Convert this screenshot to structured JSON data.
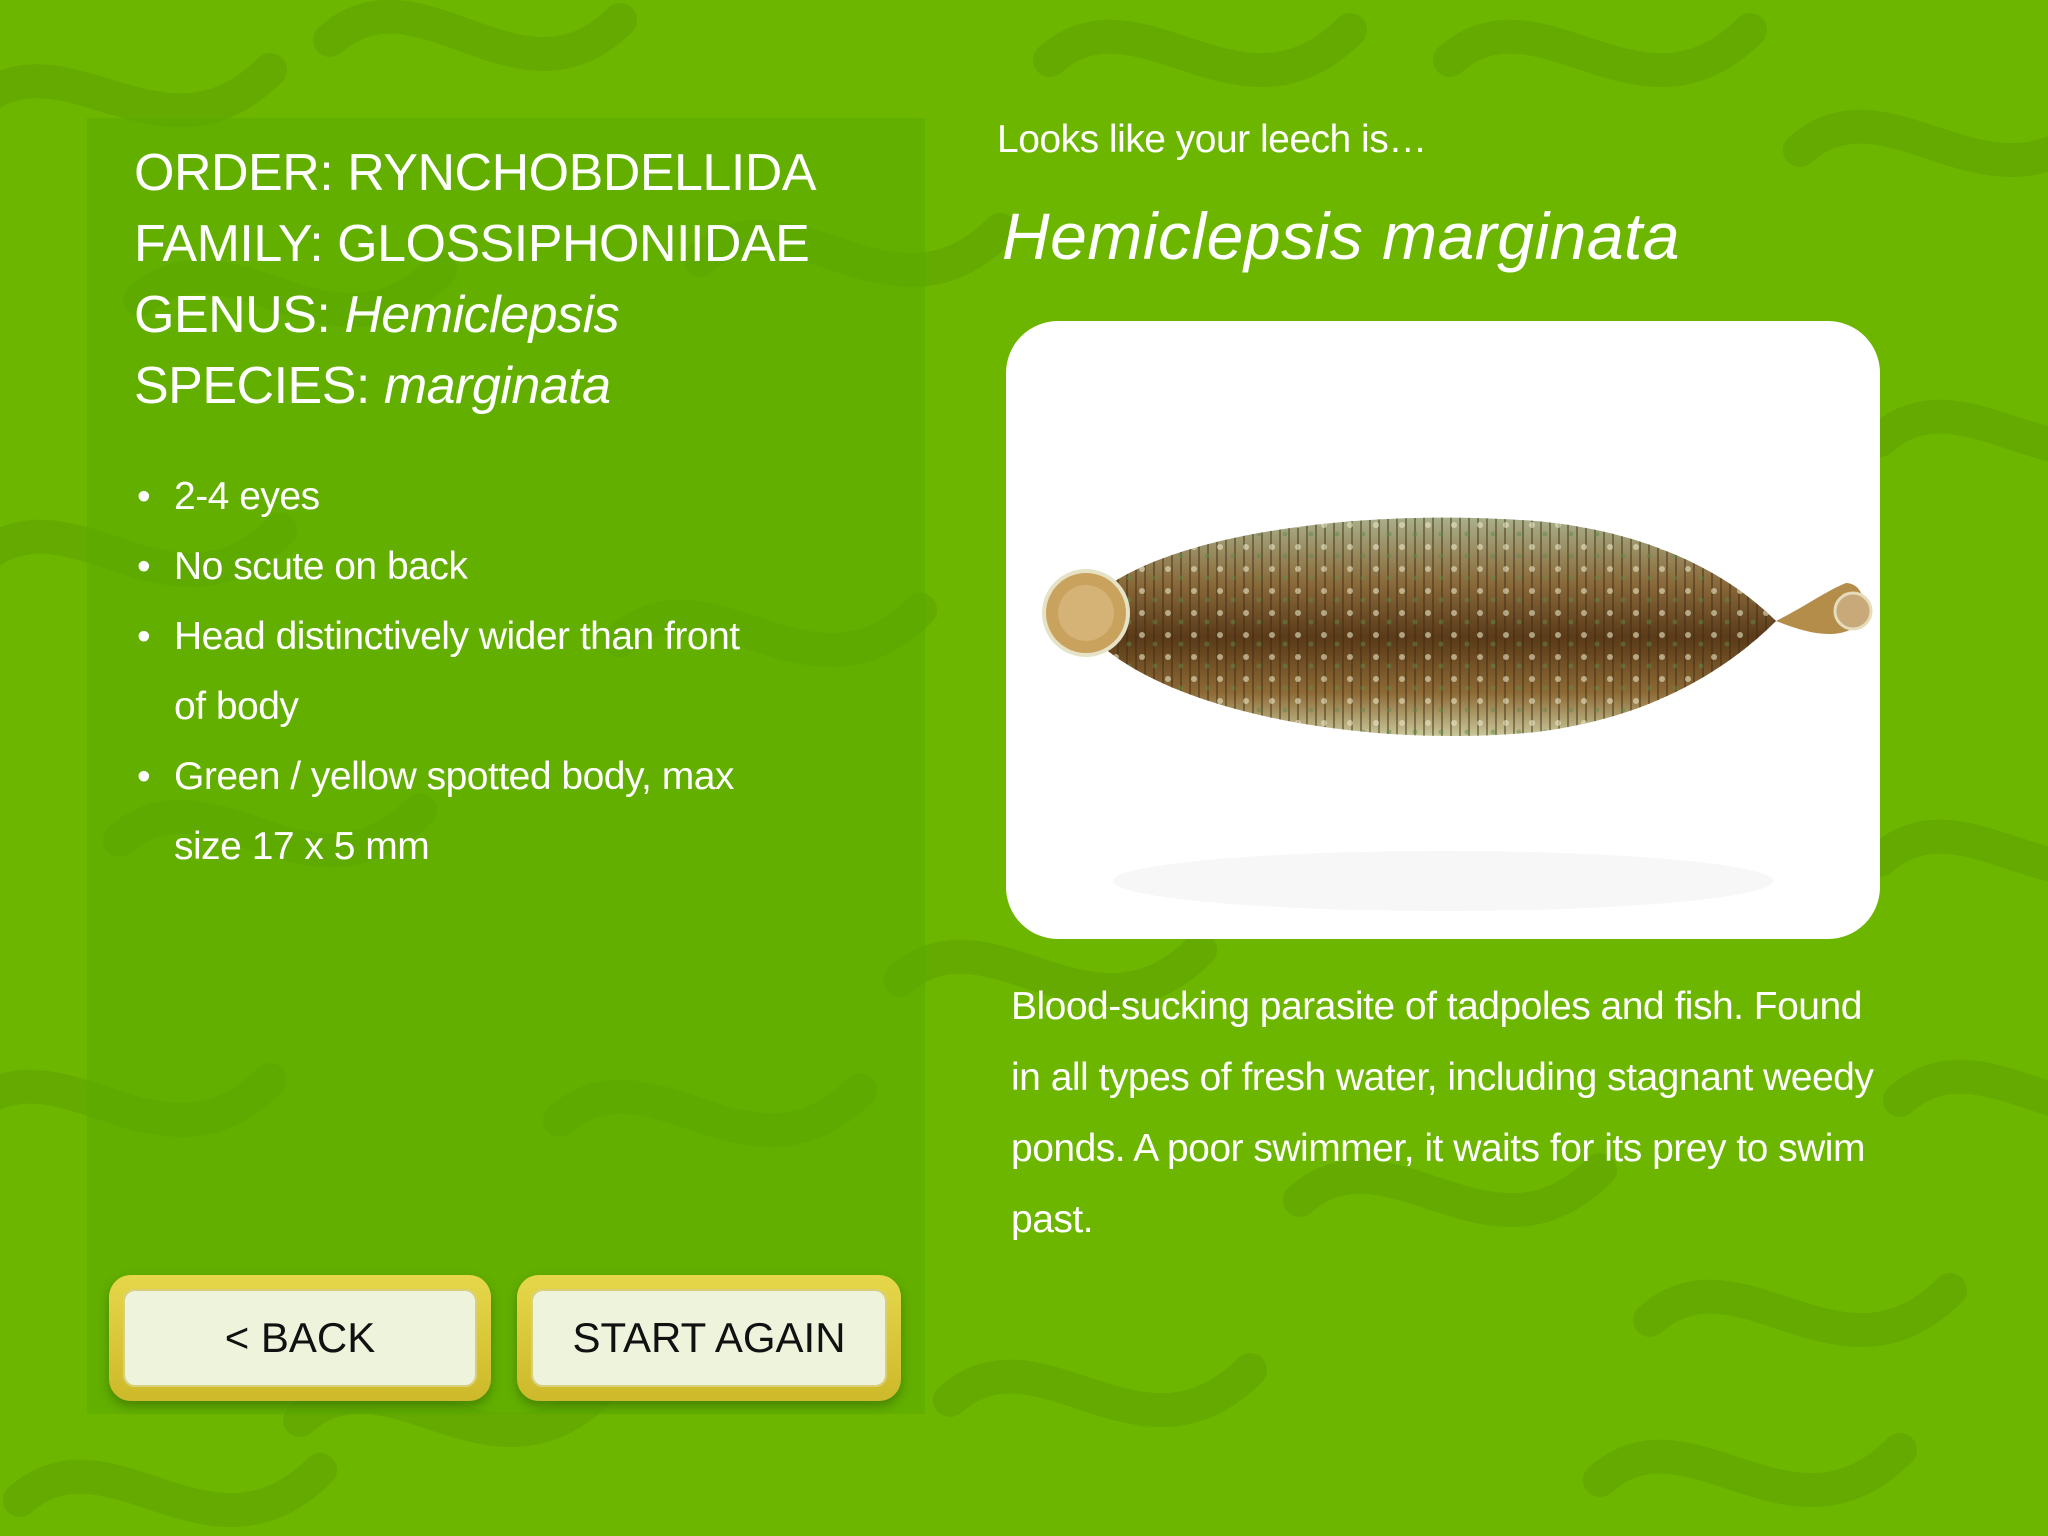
{
  "taxonomy": {
    "order_label": "ORDER: ",
    "order_value": "RYNCHOBDELLIDA",
    "family_label": "FAMILY: ",
    "family_value": "GLOSSIPHONIIDAE",
    "genus_label": "GENUS: ",
    "genus_value": "Hemiclepsis",
    "species_label": "SPECIES: ",
    "species_value": "marginata"
  },
  "features": [
    "2-4 eyes",
    "No scute on back",
    "Head distinctively wider than front of body",
    "Green / yellow spotted body, max size 17 x 5 mm"
  ],
  "bullet_char": "•",
  "result": {
    "intro": "Looks like your leech is…",
    "species_name": "Hemiclepsis marginata"
  },
  "description": "Blood-sucking parasite of tadpoles and fish. Found in all types of fresh water, including stagnant weedy ponds. A poor swimmer, it waits for its prey to swim past.",
  "buttons": {
    "back_label": "< BACK",
    "start_again_label": "START AGAIN"
  },
  "colors": {
    "background": "#6db600",
    "panel": "#5aaa00",
    "button_border": "#d4c232",
    "button_face": "#eef3dc",
    "text": "#ffffff"
  },
  "icons": {
    "background": "leech-pattern-icon",
    "photo": "leech-photo"
  }
}
